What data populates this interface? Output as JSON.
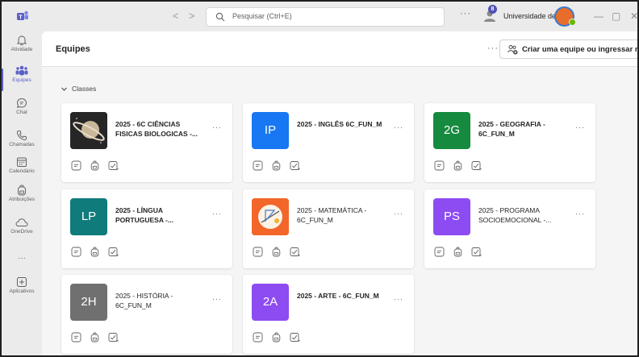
{
  "titlebar": {
    "back_glyph": "<",
    "forward_glyph": ">",
    "search_placeholder": "Pesquisar (Ctrl+E)",
    "more_glyph": "···",
    "notification_count": "8",
    "org_name": "Universidade de S...",
    "minimize_glyph": "—",
    "maximize_glyph": "▢",
    "close_glyph": "✕"
  },
  "rail": {
    "items": [
      {
        "label": "Atividade"
      },
      {
        "label": "Equipes"
      },
      {
        "label": "Chat"
      },
      {
        "label": "Chamadas"
      },
      {
        "label": "Calendário"
      },
      {
        "label": "Atribuições"
      },
      {
        "label": "OneDrive"
      },
      {
        "label": "···"
      },
      {
        "label": "Aplicativos"
      }
    ]
  },
  "header": {
    "title": "Equipes",
    "more_glyph": "···",
    "create_label": "Criar uma equipe ou ingressar nela"
  },
  "section": {
    "label": "Classes"
  },
  "teams": [
    {
      "name": "2025 - 6C CIÊNCIAS FISICAS BIOLOGICAS -...",
      "initials": "",
      "color": "#2e2e2e",
      "image": "saturn",
      "bold": true
    },
    {
      "name": "2025 - INGLÊS 6C_FUN_M",
      "initials": "IP",
      "color": "#1877f2",
      "bold": true
    },
    {
      "name": "2025 - GEOGRAFIA - 6C_FUN_M",
      "initials": "2G",
      "color": "#168a3e",
      "bold": true
    },
    {
      "name": "2025 - LÍNGUA PORTUGUESA -...",
      "initials": "LP",
      "color": "#0f7b7b",
      "bold": true
    },
    {
      "name": "2025 - MATEMÁTICA - 6C_FUN_M",
      "initials": "",
      "color": "#f2662a",
      "image": "math",
      "bold": false
    },
    {
      "name": "2025 - PROGRAMA SOCIOEMOCIONAL -...",
      "initials": "PS",
      "color": "#8d4bf2",
      "bold": false
    },
    {
      "name": "2025 - HISTÓRIA - 6C_FUN_M",
      "initials": "2H",
      "color": "#707070",
      "bold": false
    },
    {
      "name": "2025 - ARTE - 6C_FUN_M",
      "initials": "2A",
      "color": "#8d4bf2",
      "bold": true
    }
  ],
  "card_more_glyph": "···"
}
